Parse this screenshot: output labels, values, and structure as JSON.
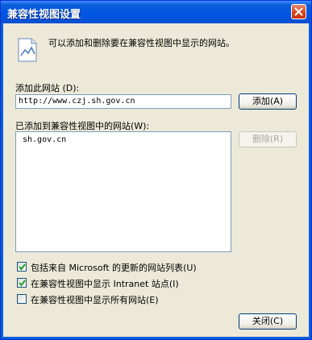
{
  "window": {
    "title": "兼容性视图设置"
  },
  "description": "可以添加和删除要在兼容性视图中显示的网站。",
  "add_site": {
    "label": "添加此网站",
    "hotkey": "(D):",
    "value": "http://www.czj.sh.gov.cn",
    "button_label": "添加",
    "button_hotkey": "(A)"
  },
  "added_sites": {
    "label": "已添加到兼容性视图中的网站",
    "hotkey": "(W):",
    "items": [
      "sh.gov.cn"
    ],
    "remove_label": "删除",
    "remove_hotkey": "(R)"
  },
  "options": [
    {
      "text": "包括来自 Microsoft 的更新的网站列表",
      "hotkey": "(U)",
      "checked": true
    },
    {
      "text": "在兼容性视图中显示 Intranet 站点",
      "hotkey": "(I)",
      "checked": true
    },
    {
      "text": "在兼容性视图中显示所有网站",
      "hotkey": "(E)",
      "checked": false
    }
  ],
  "close_button": {
    "label": "关闭",
    "hotkey": "(C)"
  },
  "colors": {
    "titlebar": "#0a5ed8",
    "dialog_bg": "#ece9d8",
    "close_red": "#d4421a"
  }
}
